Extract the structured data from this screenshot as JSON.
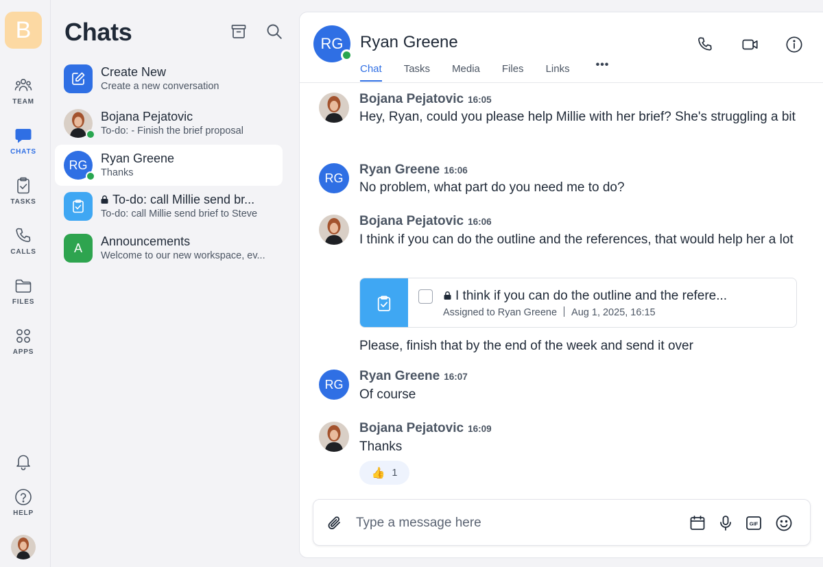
{
  "workspace": {
    "initial": "B",
    "color": "#fcd9a3"
  },
  "rail": {
    "items": [
      {
        "id": "team",
        "label": "TEAM",
        "icon": "team-icon"
      },
      {
        "id": "chats",
        "label": "CHATS",
        "icon": "chat-bubble-icon",
        "active": true
      },
      {
        "id": "tasks",
        "label": "TASKS",
        "icon": "clipboard-check-icon"
      },
      {
        "id": "calls",
        "label": "CALLS",
        "icon": "phone-icon"
      },
      {
        "id": "files",
        "label": "FILES",
        "icon": "folder-icon"
      },
      {
        "id": "apps",
        "label": "APPS",
        "icon": "apps-grid-icon"
      }
    ],
    "help_label": "HELP"
  },
  "chat_list": {
    "title": "Chats",
    "items": [
      {
        "name": "Create New",
        "preview": "Create a new conversation",
        "type": "create",
        "color": "#2f6fe4"
      },
      {
        "name": "Bojana Pejatovic",
        "preview": "To-do: - Finish the brief proposal",
        "type": "user",
        "online": true
      },
      {
        "name": "Ryan Greene",
        "preview": "Thanks",
        "type": "user",
        "initials": "RG",
        "online": true,
        "active": true
      },
      {
        "name": "To-do: call Millie send br...",
        "preview": "To-do: call Millie send brief to Steve",
        "type": "task",
        "locked": true,
        "color": "#3fa7f3"
      },
      {
        "name": "Announcements",
        "preview": "Welcome to our new workspace, ev...",
        "type": "channel",
        "initial": "A",
        "color": "#2ea44f"
      }
    ]
  },
  "conversation": {
    "name": "Ryan Greene",
    "initials": "RG",
    "online": true,
    "tabs": [
      "Chat",
      "Tasks",
      "Media",
      "Files",
      "Links"
    ],
    "active_tab": "Chat",
    "more_label": "•••",
    "messages": [
      {
        "author": "Bojana Pejatovic",
        "time": "16:05",
        "text": "Hey, Ryan, could you please help Millie with her brief? She's struggling a bit"
      },
      {
        "author": "Ryan Greene",
        "time": "16:06",
        "text": "No problem, what part do you need me to do?"
      },
      {
        "author": "Bojana Pejatovic",
        "time": "16:06",
        "text": "I think if you can do the outline and the references, that would help her a lot"
      },
      {
        "author": "Ryan Greene",
        "time": "16:07",
        "text": "Of course"
      },
      {
        "author": "Bojana Pejatovic",
        "time": "16:09",
        "text": "Thanks"
      }
    ],
    "task_card": {
      "title": "I think if you can do the outline and the refere...",
      "assigned": "Assigned to Ryan Greene",
      "date": "Aug 1, 2025, 16:15",
      "completed": false
    },
    "followup_text": "Please, finish that by the end of the week and send it over",
    "reaction": {
      "emoji": "👍",
      "count": "1"
    }
  },
  "composer": {
    "placeholder": "Type a message here"
  },
  "colors": {
    "accent": "#2f6fe4",
    "online": "#29a650",
    "task": "#3fa7f3"
  }
}
